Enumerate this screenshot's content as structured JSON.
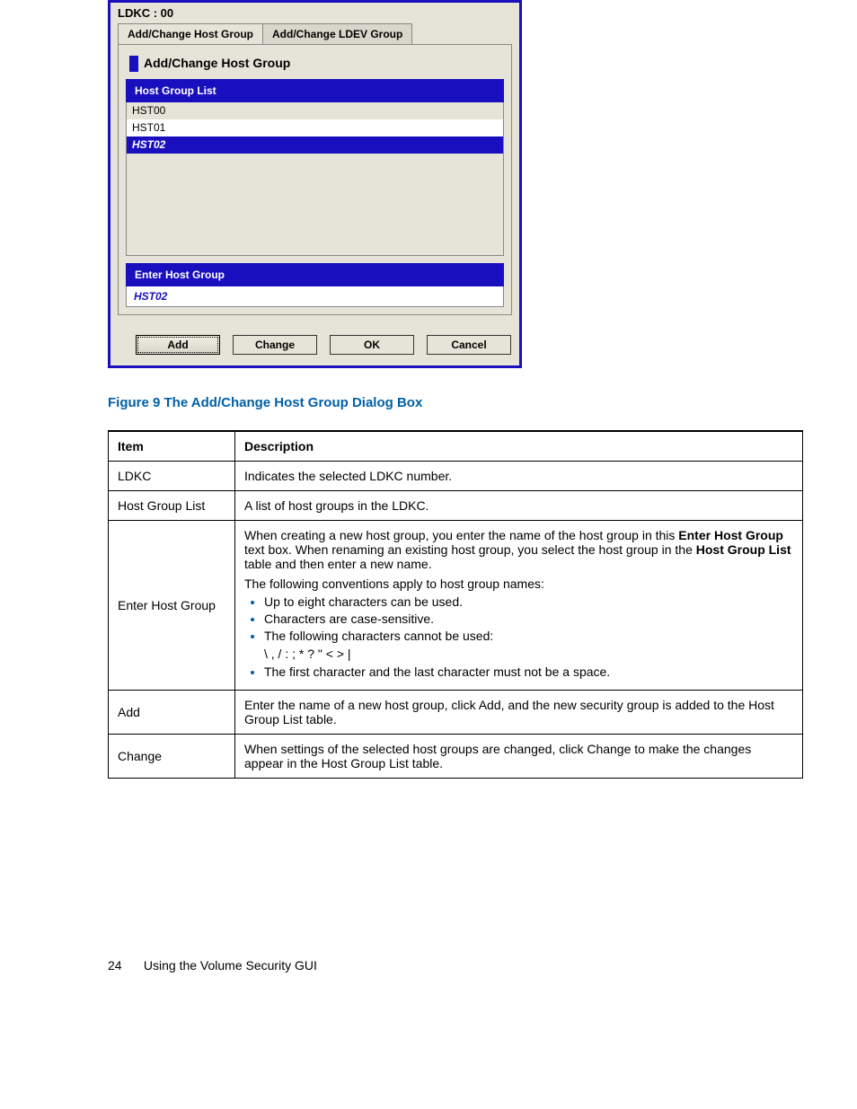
{
  "dialog": {
    "title": "LDKC : 00",
    "tabs": {
      "active": "Add/Change Host Group",
      "inactive": "Add/Change LDEV Group"
    },
    "section_title": "Add/Change Host Group",
    "list_header": "Host Group List",
    "list_items": [
      "HST00",
      "HST01",
      "HST02"
    ],
    "entry_header": "Enter Host Group",
    "entry_value": "HST02",
    "buttons": {
      "add": "Add",
      "change": "Change",
      "ok": "OK",
      "cancel": "Cancel"
    }
  },
  "figure_caption": "Figure 9 The Add/Change Host Group Dialog Box",
  "table": {
    "headers": {
      "item": "Item",
      "desc": "Description"
    },
    "rows": {
      "ldkc": {
        "item": "LDKC",
        "desc": "Indicates the selected LDKC number."
      },
      "hgl": {
        "item": "Host Group List",
        "desc": "A list of host groups in the LDKC."
      },
      "ehg": {
        "item": "Enter Host Group",
        "p1a": "When creating a new host group, you enter the name of the host group in this ",
        "p1b": "Enter Host Group",
        "p1c": " text box. When renaming an existing host group, you select the host group in the ",
        "p1d": "Host Group List",
        "p1e": " table and then enter a new name.",
        "p2": "The following conventions apply to host group names:",
        "b1": "Up to eight characters can be used.",
        "b2": "Characters are case-sensitive.",
        "b3": "The following characters cannot be used:",
        "chars": "\\ , / : ; * ? \" < > |",
        "b4": "The first character and the last character must not be a space."
      },
      "add": {
        "item": "Add",
        "desc": "Enter the name of a new host group, click Add, and the new security group is added to the Host Group List table."
      },
      "chg": {
        "item": "Change",
        "desc": "When settings of the selected host groups are changed, click Change to make the changes appear in the Host Group List table."
      }
    }
  },
  "footer": {
    "page": "24",
    "title": "Using the Volume Security GUI"
  }
}
